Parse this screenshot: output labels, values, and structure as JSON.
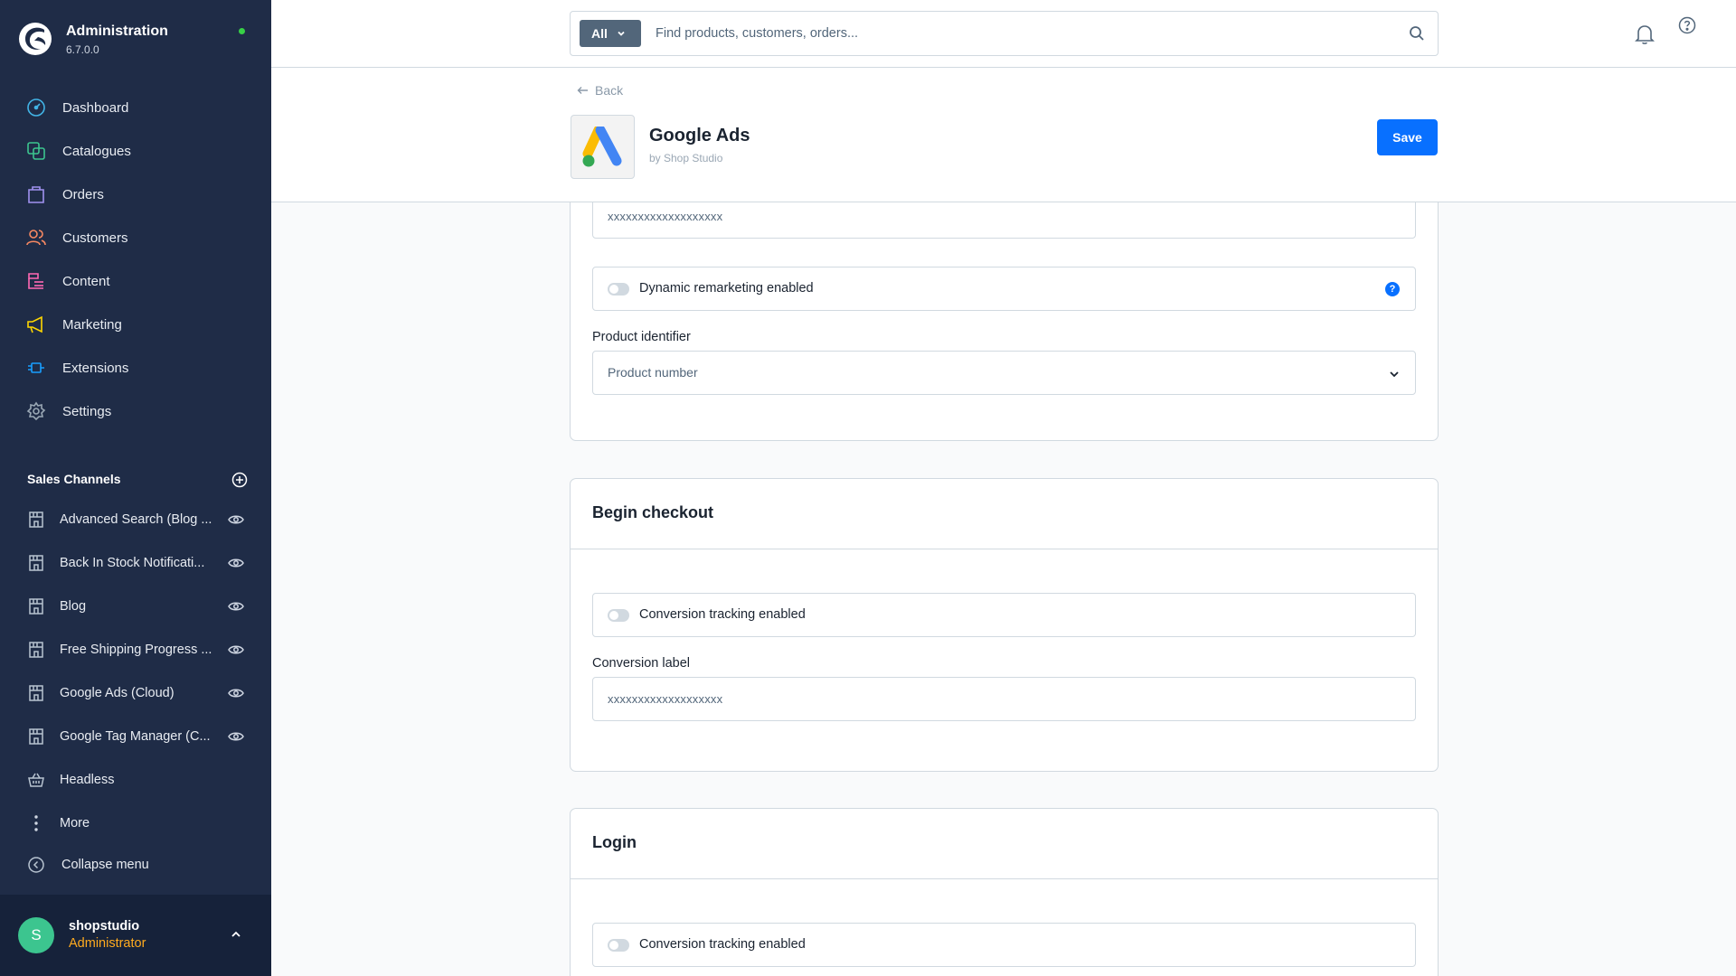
{
  "app": {
    "title": "Administration",
    "version": "6.7.0.0",
    "status_color": "#37d046",
    "sidebar_bg": "#1f2c47",
    "accent": "#0870ff"
  },
  "nav": [
    {
      "id": "dashboard",
      "label": "Dashboard",
      "icon": "dashboard-icon"
    },
    {
      "id": "catalogues",
      "label": "Catalogues",
      "icon": "catalogues-icon"
    },
    {
      "id": "orders",
      "label": "Orders",
      "icon": "orders-icon"
    },
    {
      "id": "customers",
      "label": "Customers",
      "icon": "customers-icon"
    },
    {
      "id": "content",
      "label": "Content",
      "icon": "content-icon"
    },
    {
      "id": "marketing",
      "label": "Marketing",
      "icon": "marketing-icon"
    },
    {
      "id": "extensions",
      "label": "Extensions",
      "icon": "extensions-icon"
    },
    {
      "id": "settings",
      "label": "Settings",
      "icon": "settings-icon"
    }
  ],
  "sales_channels": {
    "title": "Sales Channels",
    "items": [
      {
        "label": "Advanced Search (Blog ...",
        "icon": "storefront-icon"
      },
      {
        "label": "Back In Stock Notificati...",
        "icon": "storefront-icon"
      },
      {
        "label": "Blog",
        "icon": "storefront-icon"
      },
      {
        "label": "Free Shipping Progress ...",
        "icon": "storefront-icon"
      },
      {
        "label": "Google Ads (Cloud)",
        "icon": "storefront-icon"
      },
      {
        "label": "Google Tag Manager (C...",
        "icon": "storefront-icon"
      },
      {
        "label": "Headless",
        "icon": "headless-icon"
      }
    ],
    "more_label": "More",
    "collapse_label": "Collapse menu"
  },
  "user": {
    "initial": "S",
    "name": "shopstudio",
    "role": "Administrator"
  },
  "search": {
    "type_label": "All",
    "placeholder": "Find products, customers, orders..."
  },
  "smartbar": {
    "back_label": "Back",
    "app_name": "Google Ads",
    "vendor": "by Shop Studio",
    "save_label": "Save"
  },
  "card1": {
    "top_value": "xxxxxxxxxxxxxxxxxxx",
    "remarketing_label": "Dynamic remarketing enabled",
    "remarketing_enabled": false,
    "help_glyph": "?",
    "identifier_label": "Product identifier",
    "identifier_value": "Product number"
  },
  "card2": {
    "title": "Begin checkout",
    "tracking_label": "Conversion tracking enabled",
    "tracking_enabled": false,
    "conversion_label": "Conversion label",
    "conversion_value": "xxxxxxxxxxxxxxxxxxx"
  },
  "card3": {
    "title": "Login",
    "tracking_label": "Conversion tracking enabled",
    "tracking_enabled": false
  }
}
